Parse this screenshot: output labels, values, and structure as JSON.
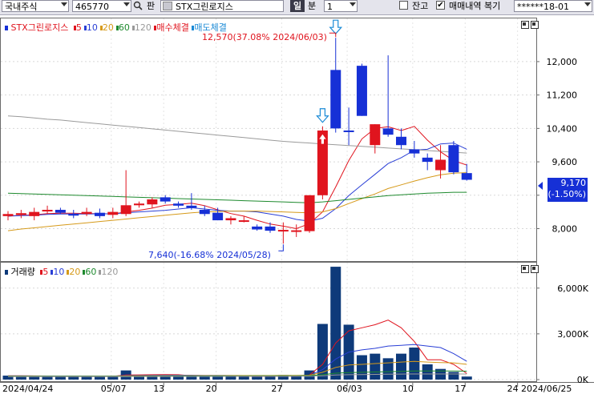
{
  "toolbar": {
    "market_select": "국내주식",
    "code_input": "465770",
    "pan_label": "판",
    "stock_name": "STX그린로지스",
    "period_day": "일",
    "period_min": "분",
    "period_value": "1",
    "balance_label": "잔고",
    "balance_checked": false,
    "trade_history_label": "매매내역 복기",
    "trade_history_checked": true,
    "account": "******18-01"
  },
  "price_panel": {
    "title": "STX그린로지스",
    "ma_legend": [
      {
        "label": "5",
        "color": "#e0141e"
      },
      {
        "label": "10",
        "color": "#2a3fd6"
      },
      {
        "label": "20",
        "color": "#d69a1a"
      },
      {
        "label": "60",
        "color": "#1e8a2e"
      },
      {
        "label": "120",
        "color": "#9a9a9a"
      }
    ],
    "buy_label": "매수체결",
    "sell_label": "매도체결",
    "high_annotation": "12,570(37.08% 2024/06/03)",
    "low_annotation": "7,640(-16.68% 2024/05/28)",
    "current_price": "9,170",
    "current_change": "(-1.50%)"
  },
  "volume_panel": {
    "title": "거래량",
    "ma_legend": [
      {
        "label": "5",
        "color": "#e0141e"
      },
      {
        "label": "10",
        "color": "#2a3fd6"
      },
      {
        "label": "20",
        "color": "#d69a1a"
      },
      {
        "label": "60",
        "color": "#1e8a2e"
      },
      {
        "label": "120",
        "color": "#9a9a9a"
      }
    ]
  },
  "x_axis": {
    "start_label": "2024/04/24",
    "end_label": "2024/06/25",
    "ticks": [
      "05/07",
      "13",
      "20",
      "27",
      "06/03",
      "10",
      "17",
      "24"
    ]
  },
  "chart_data": [
    {
      "type": "candlestick",
      "title": "STX그린로지스",
      "y_axis_ticks": [
        8000,
        8800,
        9600,
        10400,
        11200,
        12000
      ],
      "ylim": [
        7300,
        12900
      ],
      "up_color": "#e0141e",
      "down_color": "#1630d6",
      "candles": [
        {
          "o": 8300,
          "h": 8420,
          "l": 8200,
          "c": 8350
        },
        {
          "o": 8330,
          "h": 8450,
          "l": 8250,
          "c": 8370
        },
        {
          "o": 8300,
          "h": 8500,
          "l": 8200,
          "c": 8400
        },
        {
          "o": 8450,
          "h": 8550,
          "l": 8350,
          "c": 8450
        },
        {
          "o": 8450,
          "h": 8500,
          "l": 8350,
          "c": 8380
        },
        {
          "o": 8350,
          "h": 8450,
          "l": 8250,
          "c": 8320
        },
        {
          "o": 8350,
          "h": 8500,
          "l": 8300,
          "c": 8400
        },
        {
          "o": 8380,
          "h": 8480,
          "l": 8250,
          "c": 8300
        },
        {
          "o": 8330,
          "h": 8500,
          "l": 8250,
          "c": 8400
        },
        {
          "o": 8350,
          "h": 9400,
          "l": 8300,
          "c": 8560
        },
        {
          "o": 8560,
          "h": 8650,
          "l": 8500,
          "c": 8600
        },
        {
          "o": 8580,
          "h": 8750,
          "l": 8500,
          "c": 8700
        },
        {
          "o": 8750,
          "h": 8800,
          "l": 8600,
          "c": 8650
        },
        {
          "o": 8600,
          "h": 8650,
          "l": 8500,
          "c": 8550
        },
        {
          "o": 8550,
          "h": 8850,
          "l": 8450,
          "c": 8500
        },
        {
          "o": 8450,
          "h": 8550,
          "l": 8300,
          "c": 8350
        },
        {
          "o": 8380,
          "h": 8500,
          "l": 8200,
          "c": 8200
        },
        {
          "o": 8200,
          "h": 8300,
          "l": 8100,
          "c": 8250
        },
        {
          "o": 8200,
          "h": 8300,
          "l": 8150,
          "c": 8200
        },
        {
          "o": 8050,
          "h": 8100,
          "l": 7950,
          "c": 7980
        },
        {
          "o": 8050,
          "h": 8150,
          "l": 7900,
          "c": 7950
        },
        {
          "o": 7950,
          "h": 8150,
          "l": 7640,
          "c": 7970
        },
        {
          "o": 7950,
          "h": 8100,
          "l": 7800,
          "c": 7960
        },
        {
          "o": 7940,
          "h": 8800,
          "l": 7900,
          "c": 8800
        },
        {
          "o": 8800,
          "h": 10450,
          "l": 8700,
          "c": 10350
        },
        {
          "o": 11800,
          "h": 12570,
          "l": 10300,
          "c": 10400
        },
        {
          "o": 10350,
          "h": 10900,
          "l": 10000,
          "c": 10320
        },
        {
          "o": 11900,
          "h": 11950,
          "l": 10700,
          "c": 10700
        },
        {
          "o": 10000,
          "h": 10500,
          "l": 9800,
          "c": 10500
        },
        {
          "o": 10400,
          "h": 12150,
          "l": 10200,
          "c": 10250
        },
        {
          "o": 10200,
          "h": 10400,
          "l": 9900,
          "c": 10000
        },
        {
          "o": 9900,
          "h": 10100,
          "l": 9700,
          "c": 9800
        },
        {
          "o": 9700,
          "h": 9800,
          "l": 9400,
          "c": 9600
        },
        {
          "o": 9400,
          "h": 10000,
          "l": 9200,
          "c": 9650
        },
        {
          "o": 10000,
          "h": 10100,
          "l": 9300,
          "c": 9350
        },
        {
          "o": 9330,
          "h": 9550,
          "l": 9150,
          "c": 9170
        }
      ],
      "moving_averages": [
        {
          "name": "5",
          "color": "#e0141e",
          "values": [
            8300,
            8320,
            8330,
            8360,
            8370,
            8370,
            8360,
            8360,
            8350,
            8400,
            8440,
            8490,
            8560,
            8580,
            8610,
            8550,
            8450,
            8360,
            8300,
            8200,
            8110,
            8060,
            8000,
            8120,
            8400,
            9000,
            9630,
            10150,
            10400,
            10440,
            10350,
            10450,
            10120,
            9840,
            9630,
            9520
          ]
        },
        {
          "name": "10",
          "color": "#2a3fd6",
          "values": [
            8300,
            8310,
            8320,
            8340,
            8350,
            8350,
            8350,
            8355,
            8355,
            8380,
            8400,
            8420,
            8440,
            8470,
            8500,
            8470,
            8440,
            8420,
            8420,
            8400,
            8350,
            8300,
            8220,
            8180,
            8250,
            8480,
            8790,
            9050,
            9300,
            9560,
            9700,
            9880,
            9900,
            10030,
            10050,
            9900
          ]
        },
        {
          "name": "20",
          "color": "#d69a1a",
          "values": [
            7950,
            7990,
            8020,
            8050,
            8080,
            8110,
            8140,
            8170,
            8200,
            8230,
            8260,
            8290,
            8320,
            8350,
            8380,
            8400,
            8410,
            8420,
            8420,
            8420,
            8410,
            8400,
            8390,
            8380,
            8400,
            8480,
            8600,
            8720,
            8830,
            8960,
            9050,
            9140,
            9220,
            9290,
            9330,
            9340
          ]
        },
        {
          "name": "60",
          "color": "#1e8a2e",
          "values": [
            8850,
            8840,
            8830,
            8820,
            8810,
            8800,
            8790,
            8780,
            8770,
            8760,
            8750,
            8740,
            8730,
            8720,
            8710,
            8700,
            8690,
            8680,
            8670,
            8660,
            8650,
            8640,
            8630,
            8620,
            8640,
            8670,
            8700,
            8730,
            8760,
            8790,
            8810,
            8830,
            8850,
            8860,
            8870,
            8870
          ]
        },
        {
          "name": "120",
          "color": "#9a9a9a",
          "values": [
            10700,
            10680,
            10650,
            10620,
            10600,
            10570,
            10540,
            10510,
            10480,
            10450,
            10420,
            10390,
            10360,
            10330,
            10300,
            10270,
            10240,
            10210,
            10180,
            10150,
            10120,
            10090,
            10070,
            10050,
            10030,
            10010,
            9990,
            9970,
            9950,
            9930,
            9910,
            9890,
            9870,
            9850,
            9830,
            9810
          ]
        }
      ],
      "buy_marker_index": 24,
      "sell_marker_indices": [
        24,
        25
      ]
    },
    {
      "type": "bar",
      "title": "거래량",
      "y_axis_ticks": [
        {
          "v": 0,
          "label": "0K"
        },
        {
          "v": 3000,
          "label": "3,000K"
        },
        {
          "v": 6000,
          "label": "6,000K"
        }
      ],
      "ylim": [
        0,
        7300
      ],
      "bar_color": "#0e3a7a",
      "values": [
        260,
        240,
        230,
        220,
        200,
        210,
        220,
        200,
        220,
        600,
        300,
        250,
        240,
        220,
        230,
        200,
        260,
        210,
        200,
        180,
        190,
        300,
        220,
        600,
        3650,
        7400,
        3600,
        1600,
        1700,
        1400,
        1700,
        2100,
        1000,
        700,
        500,
        200
      ],
      "moving_averages": [
        {
          "name": "5",
          "color": "#e0141e",
          "values": [
            250,
            245,
            240,
            235,
            230,
            225,
            220,
            215,
            215,
            300,
            310,
            320,
            330,
            320,
            250,
            230,
            240,
            230,
            220,
            210,
            210,
            220,
            220,
            300,
            1000,
            2400,
            3200,
            3400,
            3600,
            3900,
            3400,
            2500,
            1300,
            1300,
            1000,
            400
          ]
        },
        {
          "name": "10",
          "color": "#2a3fd6",
          "values": [
            240,
            240,
            238,
            236,
            234,
            232,
            230,
            228,
            226,
            260,
            270,
            280,
            290,
            290,
            290,
            280,
            280,
            270,
            260,
            240,
            230,
            230,
            230,
            260,
            650,
            1350,
            1800,
            1950,
            2050,
            2200,
            2250,
            2300,
            2200,
            2100,
            1700,
            1200
          ]
        },
        {
          "name": "20",
          "color": "#d69a1a",
          "values": [
            230,
            230,
            230,
            228,
            226,
            224,
            222,
            220,
            220,
            240,
            245,
            250,
            255,
            258,
            260,
            262,
            264,
            266,
            268,
            270,
            270,
            272,
            274,
            290,
            480,
            800,
            960,
            1000,
            1050,
            1100,
            1150,
            1200,
            1150,
            1120,
            1100,
            1000
          ]
        },
        {
          "name": "60",
          "color": "#1e8a2e",
          "values": [
            220,
            220,
            220,
            220,
            220,
            220,
            220,
            220,
            220,
            225,
            228,
            230,
            232,
            234,
            236,
            238,
            240,
            242,
            244,
            246,
            248,
            250,
            252,
            260,
            320,
            420,
            460,
            480,
            500,
            520,
            540,
            560,
            560,
            560,
            560,
            550
          ]
        },
        {
          "name": "120",
          "color": "#9a9a9a",
          "values": [
            200,
            200,
            200,
            200,
            200,
            200,
            200,
            200,
            200,
            205,
            206,
            207,
            208,
            209,
            210,
            211,
            212,
            213,
            214,
            215,
            216,
            217,
            218,
            222,
            250,
            300,
            320,
            330,
            340,
            350,
            360,
            370,
            370,
            370,
            370,
            370
          ]
        }
      ]
    }
  ]
}
